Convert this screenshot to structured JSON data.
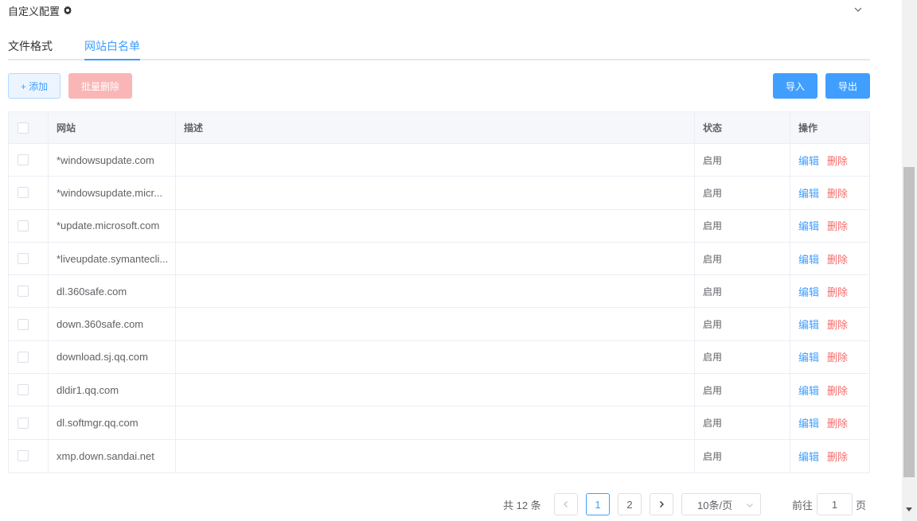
{
  "header": {
    "title": "自定义配置",
    "settings_icon": "gear-icon",
    "collapse_icon": "chevron-down-icon"
  },
  "tabs": [
    {
      "label": "文件格式",
      "active": false
    },
    {
      "label": "网站白名单",
      "active": true
    }
  ],
  "toolbar": {
    "add_label": "+ 添加",
    "bulk_delete_label": "批量删除",
    "import_label": "导入",
    "export_label": "导出"
  },
  "table": {
    "columns": {
      "site": "网站",
      "description": "描述",
      "status": "状态",
      "actions": "操作"
    },
    "rows": [
      {
        "site": "*windowsupdate.com",
        "description": "",
        "status": "启用"
      },
      {
        "site": "*windowsupdate.micr...",
        "description": "",
        "status": "启用"
      },
      {
        "site": "*update.microsoft.com",
        "description": "",
        "status": "启用"
      },
      {
        "site": "*liveupdate.symantecli...",
        "description": "",
        "status": "启用"
      },
      {
        "site": "dl.360safe.com",
        "description": "",
        "status": "启用"
      },
      {
        "site": "down.360safe.com",
        "description": "",
        "status": "启用"
      },
      {
        "site": "download.sj.qq.com",
        "description": "",
        "status": "启用"
      },
      {
        "site": "dldir1.qq.com",
        "description": "",
        "status": "启用"
      },
      {
        "site": "dl.softmgr.qq.com",
        "description": "",
        "status": "启用"
      },
      {
        "site": "xmp.down.sandai.net",
        "description": "",
        "status": "启用"
      }
    ],
    "edit_label": "编辑",
    "delete_label": "删除"
  },
  "pagination": {
    "total_text": "共 12 条",
    "pages": [
      "1",
      "2"
    ],
    "current_page": "1",
    "page_size": "10条/页",
    "goto_label": "前往",
    "goto_value": "1",
    "goto_suffix": "页"
  },
  "colors": {
    "primary": "#409eff",
    "danger": "#f56c6c",
    "danger_disabled": "#fab6b6",
    "border": "#ebeef5"
  }
}
